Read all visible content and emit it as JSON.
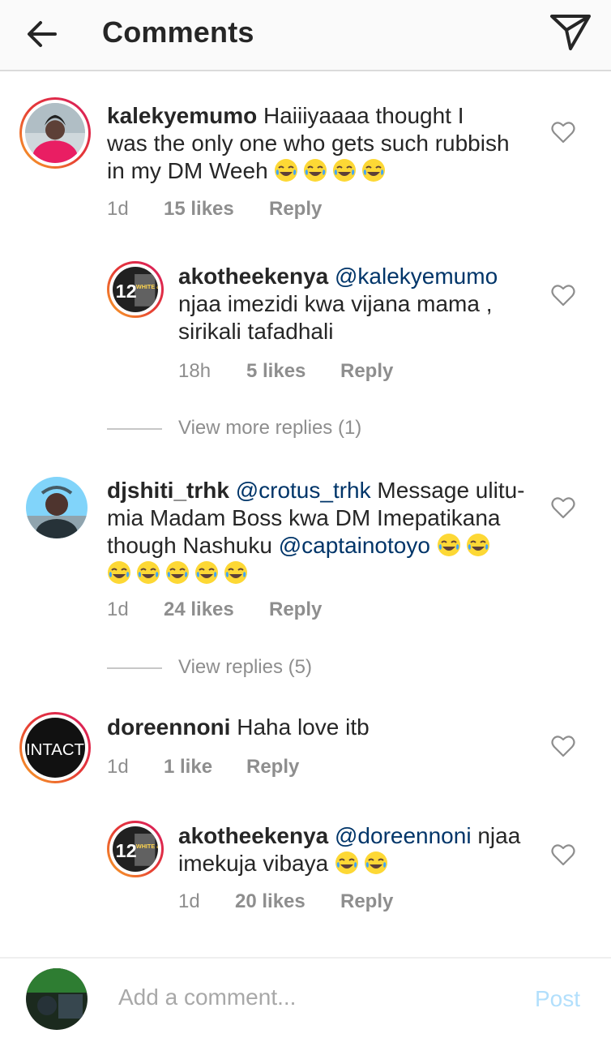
{
  "header": {
    "title": "Comments"
  },
  "comments": [
    {
      "user": "kalekyemumo",
      "text_lines": [
        "Haiiiyaaaa thought I",
        "was the only one who gets such rubbish",
        "in my DM Weeh"
      ],
      "time": "1d",
      "likes": "15 likes",
      "reply": "Reply"
    },
    {
      "user": "akotheekenya",
      "mention": "@kalekyemumo",
      "text_lines": [
        "njaa imezidi kwa vijana mama ,",
        "sirikali tafadhali"
      ],
      "time": "18h",
      "likes": "5 likes",
      "reply": "Reply"
    },
    {
      "user": "djshiti_trhk",
      "mention": "@crotus_trhk",
      "text_lines": [
        "Message ulitu-",
        "mia Madam Boss kwa DM Imepatikana",
        "though Nashuku"
      ],
      "mention2": "@captainotoyo",
      "time": "1d",
      "likes": "24 likes",
      "reply": "Reply"
    },
    {
      "user": "doreennoni",
      "text_lines": [
        "Haha love itb"
      ],
      "time": "1d",
      "likes": "1 like",
      "reply": "Reply"
    },
    {
      "user": "akotheekenya",
      "mention": "@doreennoni",
      "text_lines": [
        "njaa",
        "imekuja vibaya"
      ],
      "time": "1d",
      "likes": "20 likes",
      "reply": "Reply"
    }
  ],
  "view_more": [
    "View more replies (1)",
    "View replies (5)"
  ],
  "avatars": {
    "intact_text": "INTACT",
    "poster_number": "12",
    "poster_text": "WHITE & GOLD"
  },
  "composer": {
    "placeholder": "Add a comment...",
    "post_label": "Post"
  },
  "colors": {
    "mention": "#003569",
    "meta": "#8e8e8e",
    "post_disabled": "#b2dffc"
  },
  "icons": [
    "back-arrow-icon",
    "send-icon",
    "heart-icon",
    "tears-of-joy-emoji"
  ]
}
